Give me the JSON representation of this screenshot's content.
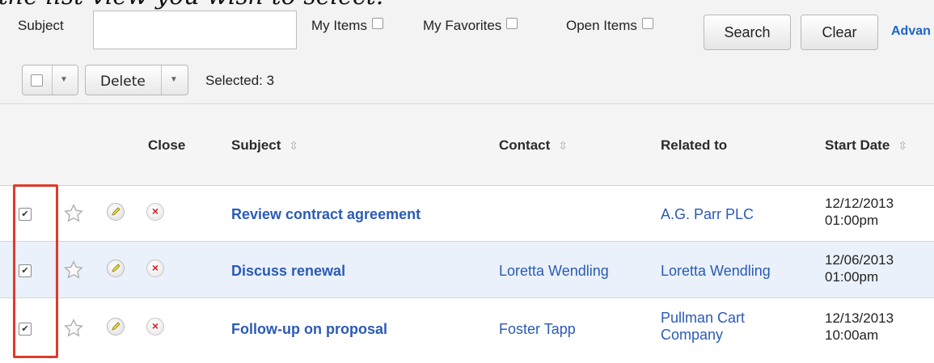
{
  "intro_text": "the list view you wish to select.",
  "search": {
    "subject_label": "Subject",
    "subject_value": "",
    "filters": [
      "My Items",
      "My Favorites",
      "Open Items"
    ],
    "search_label": "Search",
    "clear_label": "Clear",
    "advanced_label": "Advan"
  },
  "actions": {
    "delete_label": "Delete",
    "selected_text": "Selected: 3"
  },
  "columns": {
    "close": "Close",
    "subject": "Subject",
    "contact": "Contact",
    "related": "Related to",
    "start": "Start Date"
  },
  "rows": [
    {
      "checked": true,
      "subject": "Review contract agreement",
      "contact": "",
      "related": "A.G. Parr PLC",
      "related2": "",
      "date": "12/12/2013",
      "time": "01:00pm"
    },
    {
      "checked": true,
      "subject": "Discuss renewal",
      "contact": "Loretta Wendling",
      "related": "Loretta Wendling",
      "related2": "",
      "date": "12/06/2013",
      "time": "01:00pm"
    },
    {
      "checked": true,
      "subject": "Follow-up on proposal",
      "contact": "Foster Tapp",
      "related": "Pullman Cart",
      "related2": "Company",
      "date": "12/13/2013",
      "time": "10:00am"
    }
  ],
  "colors": {
    "link": "#2b5bb5",
    "highlight": "#e03a2a",
    "alt_row": "#eaf1fb"
  },
  "icons": [
    "favorite-star-icon",
    "edit-pencil-icon",
    "close-x-icon",
    "chevron-down-icon",
    "sort-icon"
  ]
}
